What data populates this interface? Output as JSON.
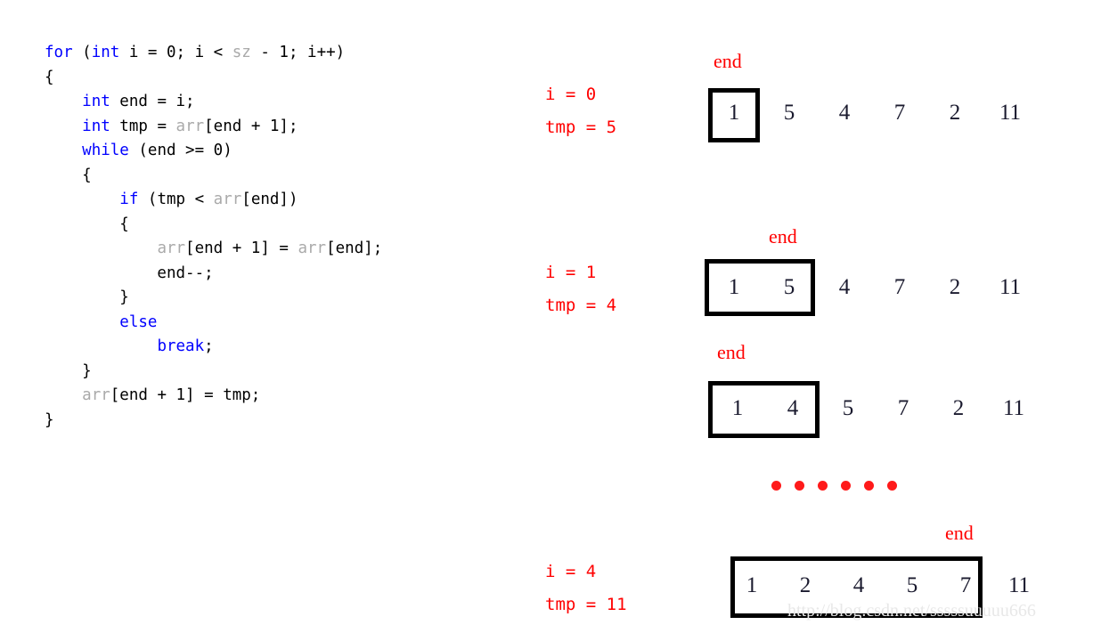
{
  "code": {
    "lines": [
      [
        {
          "t": "for",
          "c": "kw"
        },
        {
          "t": " (",
          "c": "pln"
        },
        {
          "t": "int",
          "c": "kw"
        },
        {
          "t": " i = 0; i < ",
          "c": "pln"
        },
        {
          "t": "sz",
          "c": "idn"
        },
        {
          "t": " - 1; i++)",
          "c": "pln"
        }
      ],
      [
        {
          "t": "{",
          "c": "pln"
        }
      ],
      [
        {
          "t": "    ",
          "c": "pln"
        },
        {
          "t": "int",
          "c": "kw"
        },
        {
          "t": " end = i;",
          "c": "pln"
        }
      ],
      [
        {
          "t": "    ",
          "c": "pln"
        },
        {
          "t": "int",
          "c": "kw"
        },
        {
          "t": " tmp = ",
          "c": "pln"
        },
        {
          "t": "arr",
          "c": "idn"
        },
        {
          "t": "[end + 1];",
          "c": "pln"
        }
      ],
      [
        {
          "t": "    ",
          "c": "pln"
        },
        {
          "t": "while",
          "c": "kw"
        },
        {
          "t": " (end >= 0)",
          "c": "pln"
        }
      ],
      [
        {
          "t": "    {",
          "c": "pln"
        }
      ],
      [
        {
          "t": "        ",
          "c": "pln"
        },
        {
          "t": "if",
          "c": "kw"
        },
        {
          "t": " (tmp < ",
          "c": "pln"
        },
        {
          "t": "arr",
          "c": "idn"
        },
        {
          "t": "[end])",
          "c": "pln"
        }
      ],
      [
        {
          "t": "        {",
          "c": "pln"
        }
      ],
      [
        {
          "t": "            ",
          "c": "pln"
        },
        {
          "t": "arr",
          "c": "idn"
        },
        {
          "t": "[end + 1] = ",
          "c": "pln"
        },
        {
          "t": "arr",
          "c": "idn"
        },
        {
          "t": "[end];",
          "c": "pln"
        }
      ],
      [
        {
          "t": "            end--;",
          "c": "pln"
        }
      ],
      [
        {
          "t": "        }",
          "c": "pln"
        }
      ],
      [
        {
          "t": "        ",
          "c": "pln"
        },
        {
          "t": "else",
          "c": "kw"
        },
        {
          "t": "",
          "c": "pln"
        }
      ],
      [
        {
          "t": "            ",
          "c": "pln"
        },
        {
          "t": "break",
          "c": "kw"
        },
        {
          "t": ";",
          "c": "pln"
        }
      ],
      [
        {
          "t": "    }",
          "c": "pln"
        }
      ],
      [
        {
          "t": "    ",
          "c": "pln"
        },
        {
          "t": "arr",
          "c": "idn"
        },
        {
          "t": "[end + 1] = tmp;",
          "c": "pln"
        }
      ],
      [
        {
          "t": "}",
          "c": "pln"
        }
      ]
    ]
  },
  "colors": {
    "keyword": "#0000ff",
    "identifier": "#aaaaaa",
    "annotation_red": "#ff0000",
    "box_border": "#000000",
    "cell_text": "#1a1a2e",
    "watermark": "#e8e8e8",
    "background": "#ffffff"
  },
  "steps": [
    {
      "i_label": "i = 0",
      "tmp_label": "tmp = 5",
      "end_label": "end",
      "array": [
        "1",
        "5",
        "4",
        "7",
        "2",
        "11"
      ],
      "boxed_count": 1,
      "end_index": 0
    },
    {
      "i_label": "i = 1",
      "tmp_label": "tmp = 4",
      "end_label": "end",
      "array": [
        "1",
        "5",
        "4",
        "7",
        "2",
        "11"
      ],
      "boxed_count": 2,
      "end_index": 1
    },
    {
      "i_label": "",
      "tmp_label": "",
      "end_label": "end",
      "array": [
        "1",
        "4",
        "5",
        "7",
        "2",
        "11"
      ],
      "boxed_count": 2,
      "end_index": 0
    },
    {
      "i_label": "i = 4",
      "tmp_label": "tmp = 11",
      "end_label": "end",
      "array": [
        "1",
        "2",
        "4",
        "5",
        "7",
        "11"
      ],
      "boxed_count": 5,
      "end_index": 4
    }
  ],
  "ellipsis": {
    "dot_count": 6,
    "color": "#ff1a1a"
  },
  "watermark": {
    "text": "http://blog.csdn.net/sssssuuuuu666"
  }
}
